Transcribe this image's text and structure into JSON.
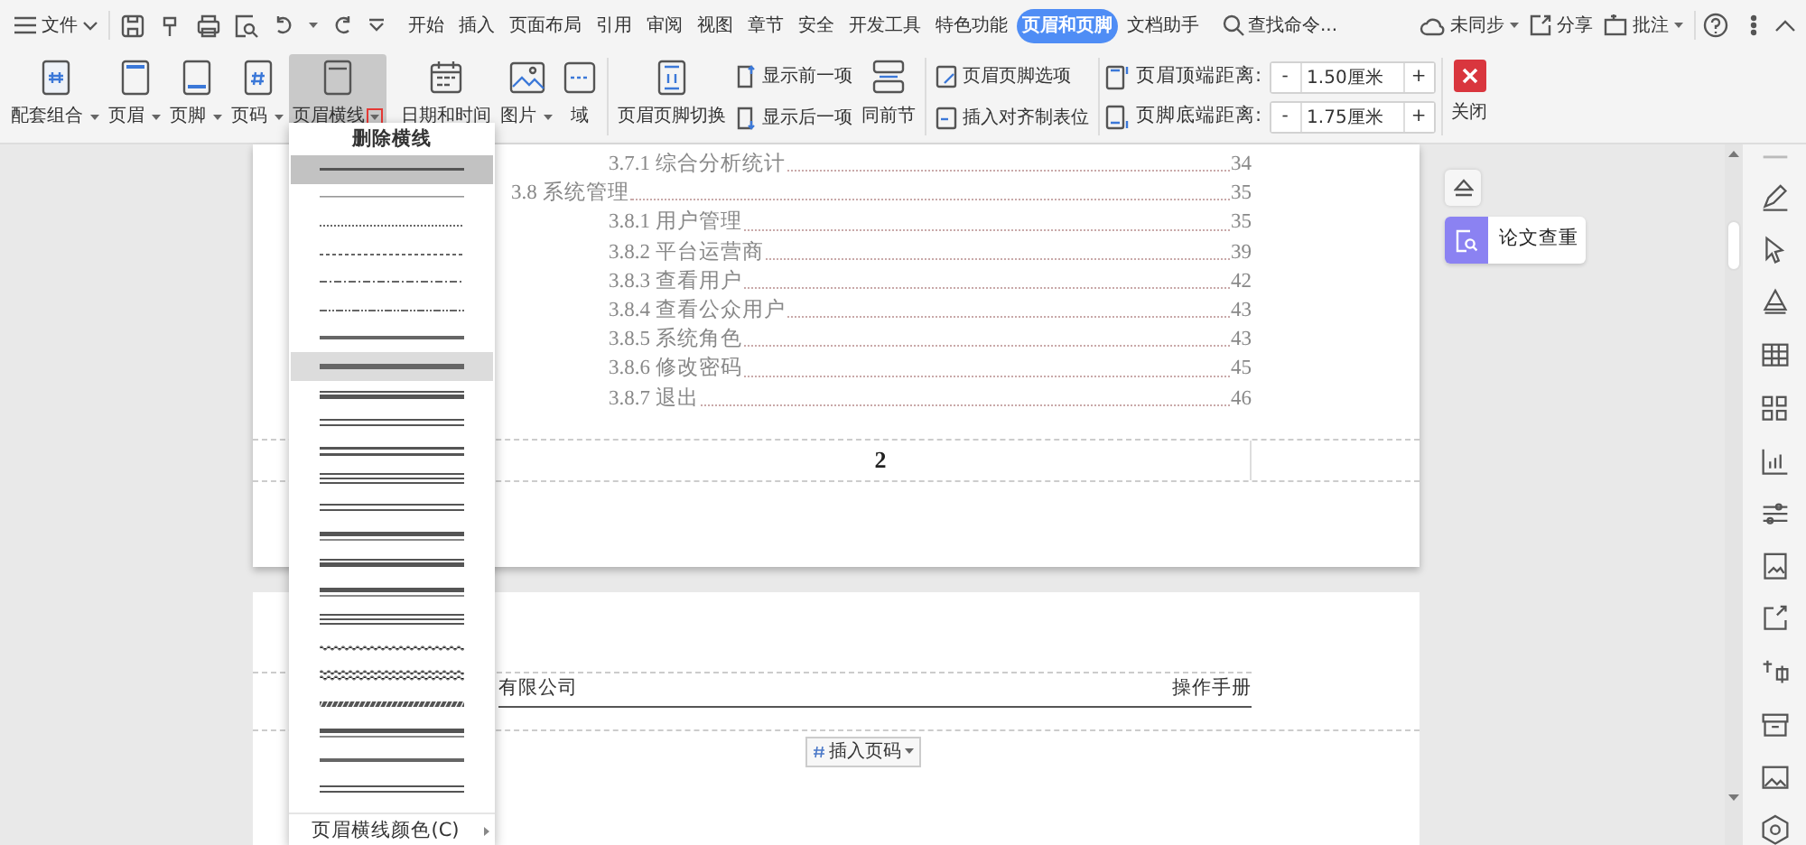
{
  "menu_bar": {
    "file_menu": "文件",
    "tabs": [
      {
        "label": "开始",
        "selected": false
      },
      {
        "label": "插入",
        "selected": false
      },
      {
        "label": "页面布局",
        "selected": false
      },
      {
        "label": "引用",
        "selected": false
      },
      {
        "label": "审阅",
        "selected": false
      },
      {
        "label": "视图",
        "selected": false
      },
      {
        "label": "章节",
        "selected": false
      },
      {
        "label": "安全",
        "selected": false
      },
      {
        "label": "开发工具",
        "selected": false
      },
      {
        "label": "特色功能",
        "selected": false
      },
      {
        "label": "页眉和页脚",
        "selected": true
      },
      {
        "label": "文档助手",
        "selected": false
      }
    ],
    "search": {
      "placeholder": "查找命令..."
    },
    "sync": "未同步",
    "share": "分享",
    "comment": "批注"
  },
  "ribbon": {
    "insert_buttons": [
      {
        "label": "配套组合",
        "has_dropdown": true,
        "pressed": false,
        "highlight_box": false
      },
      {
        "label": "页眉",
        "has_dropdown": true,
        "pressed": false,
        "highlight_box": false
      },
      {
        "label": "页脚",
        "has_dropdown": true,
        "pressed": false,
        "highlight_box": false
      },
      {
        "label": "页码",
        "has_dropdown": true,
        "pressed": false,
        "highlight_box": false
      },
      {
        "label": "页眉横线",
        "has_dropdown": true,
        "pressed": true,
        "highlight_box": true
      },
      {
        "label": "日期和时间",
        "has_dropdown": false,
        "pressed": false,
        "highlight_box": false
      },
      {
        "label": "图片",
        "has_dropdown": true,
        "pressed": false,
        "highlight_box": false
      },
      {
        "label": "域",
        "has_dropdown": false,
        "pressed": false,
        "highlight_box": false
      }
    ],
    "switch_button": "页眉页脚切换",
    "nav_buttons": [
      "显示前一项",
      "显示后一项"
    ],
    "same_as_previous": "同前节",
    "option_buttons": [
      "页眉页脚选项",
      "插入对齐制表位"
    ],
    "distances": [
      {
        "label": "页眉顶端距离:",
        "decrease": "-",
        "value": "1.50厘米",
        "increase": "+"
      },
      {
        "label": "页脚底端距离:",
        "decrease": "-",
        "value": "1.75厘米",
        "increase": "+"
      }
    ],
    "close": "关闭"
  },
  "header_line_menu": {
    "title": "删除横线",
    "line_styles": [
      {
        "kind": "single",
        "selected": true,
        "hovered": false
      },
      {
        "kind": "hairline",
        "selected": false,
        "hovered": false
      },
      {
        "kind": "dotted",
        "selected": false,
        "hovered": false
      },
      {
        "kind": "dashed",
        "selected": false,
        "hovered": false
      },
      {
        "kind": "dash-dot",
        "selected": false,
        "hovered": false
      },
      {
        "kind": "dash-dot-dot",
        "selected": false,
        "hovered": false
      },
      {
        "kind": "medium",
        "selected": false,
        "hovered": false
      },
      {
        "kind": "thick",
        "selected": false,
        "hovered": true
      },
      {
        "kind": "thin-thick",
        "selected": false,
        "hovered": false
      },
      {
        "kind": "double",
        "selected": false,
        "hovered": false
      },
      {
        "kind": "thick-double",
        "selected": false,
        "hovered": false
      },
      {
        "kind": "triple",
        "selected": false,
        "hovered": false
      },
      {
        "kind": "double",
        "selected": false,
        "hovered": false
      },
      {
        "kind": "thick-thin",
        "selected": false,
        "hovered": false
      },
      {
        "kind": "thin-thick",
        "selected": false,
        "hovered": false
      },
      {
        "kind": "thick-thin",
        "selected": false,
        "hovered": false
      },
      {
        "kind": "triple",
        "selected": false,
        "hovered": false
      },
      {
        "kind": "wavy",
        "selected": false,
        "hovered": false
      },
      {
        "kind": "double-wavy",
        "selected": false,
        "hovered": false
      },
      {
        "kind": "hatched",
        "selected": false,
        "hovered": false
      },
      {
        "kind": "thick-thin",
        "selected": false,
        "hovered": false
      },
      {
        "kind": "medium",
        "selected": false,
        "hovered": false
      },
      {
        "kind": "double",
        "selected": false,
        "hovered": false
      }
    ],
    "color_item": {
      "label": "页眉横线颜色(C)",
      "has_submenu": true
    }
  },
  "document": {
    "toc": {
      "continued": [
        {
          "title": "3.7.1  综合分析统计",
          "page": "34"
        }
      ],
      "sections": [
        {
          "title": "3.8  系统管理",
          "page": "35",
          "children": [
            {
              "title": "3.8.1  用户管理",
              "page": "35"
            },
            {
              "title": "3.8.2  平台运营商",
              "page": "39"
            },
            {
              "title": "3.8.3  查看用户",
              "page": "42"
            },
            {
              "title": "3.8.4  查看公众用户",
              "page": "43"
            },
            {
              "title": "3.8.5  系统角色",
              "page": "43"
            },
            {
              "title": "3.8.6  修改密码",
              "page": "45"
            },
            {
              "title": "3.8.7  退出",
              "page": "46"
            }
          ]
        }
      ]
    },
    "page_number": "2",
    "next_page_header": {
      "left": "有限公司",
      "right": "操作手册"
    },
    "insert_page_number": "插入页码"
  },
  "side_panel": {
    "items": [
      {
        "label": "论文查重"
      }
    ]
  }
}
